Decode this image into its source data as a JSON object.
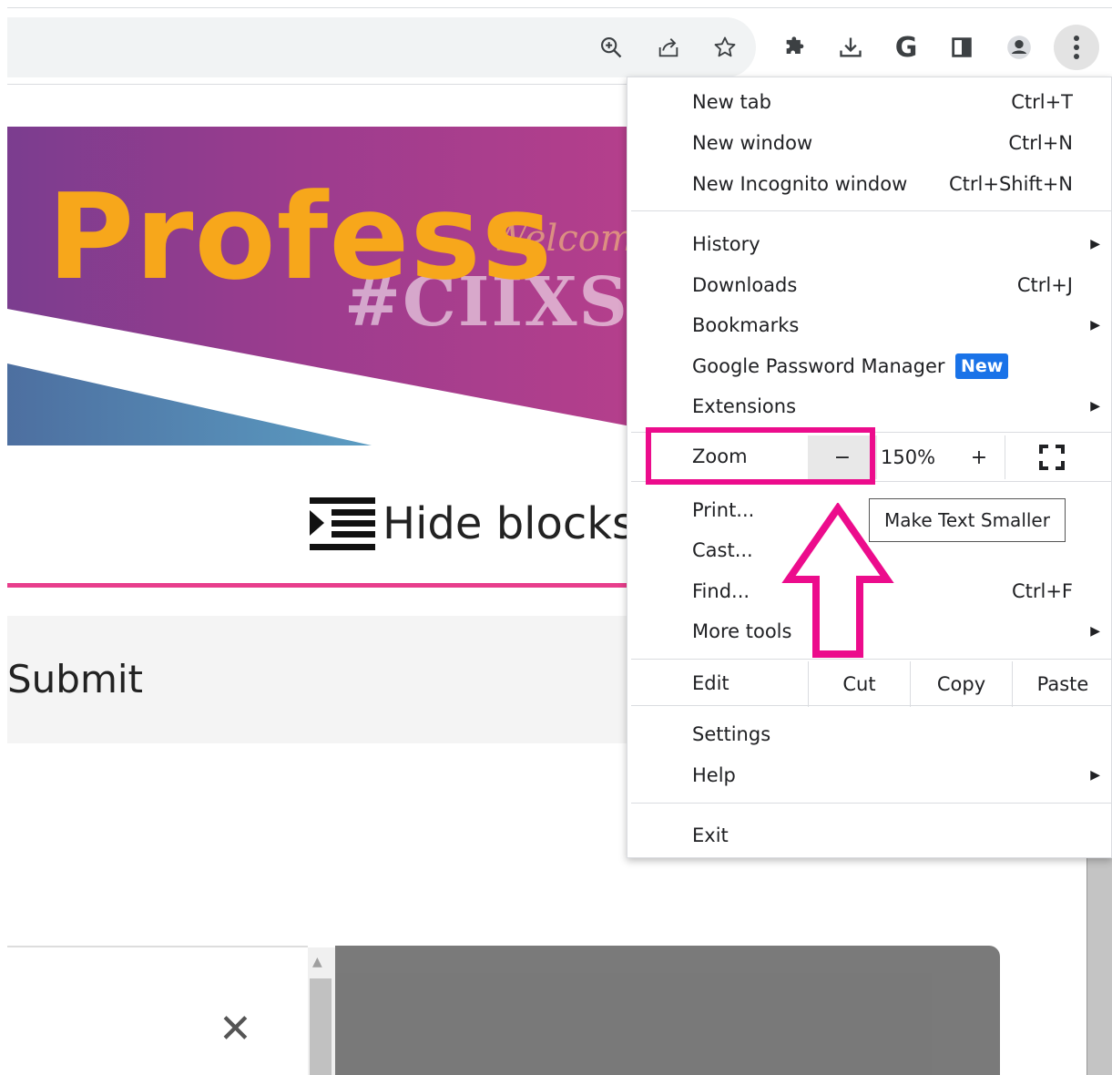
{
  "toolbar": {
    "icons": [
      "zoom-in-icon",
      "share-icon",
      "star-icon",
      "puzzle-icon",
      "download-icon",
      "google-icon",
      "side-panel-icon",
      "profile-icon",
      "three-dots-icon"
    ],
    "google_letter": "G"
  },
  "page": {
    "banner_title": "Profess",
    "banner_ghost_text": "#CIIXSTSM",
    "banner_script_text": "Welcome",
    "hide_blocks_label": "Hide blocks",
    "submit_label": "Submit",
    "close_symbol": "✕"
  },
  "menu": {
    "new_tab": {
      "label": "New tab",
      "shortcut": "Ctrl+T"
    },
    "new_window": {
      "label": "New window",
      "shortcut": "Ctrl+N"
    },
    "new_incognito": {
      "label": "New Incognito window",
      "shortcut": "Ctrl+Shift+N"
    },
    "history": {
      "label": "History"
    },
    "downloads": {
      "label": "Downloads",
      "shortcut": "Ctrl+J"
    },
    "bookmarks": {
      "label": "Bookmarks"
    },
    "password_manager": {
      "label": "Google Password Manager",
      "badge": "New"
    },
    "extensions": {
      "label": "Extensions"
    },
    "zoom": {
      "label": "Zoom",
      "minus": "−",
      "value": "150%",
      "plus": "+"
    },
    "print": {
      "label": "Print..."
    },
    "cast": {
      "label": "Cast..."
    },
    "find": {
      "label": "Find...",
      "shortcut": "Ctrl+F"
    },
    "more_tools": {
      "label": "More tools"
    },
    "edit": {
      "label": "Edit",
      "cut": "Cut",
      "copy": "Copy",
      "paste": "Paste"
    },
    "settings": {
      "label": "Settings"
    },
    "help": {
      "label": "Help"
    },
    "exit": {
      "label": "Exit"
    }
  },
  "tooltip": {
    "text": "Make Text Smaller"
  },
  "colors": {
    "highlight": "#ec0c8c",
    "badge": "#1a73e8",
    "banner_title": "#f7a71b"
  }
}
